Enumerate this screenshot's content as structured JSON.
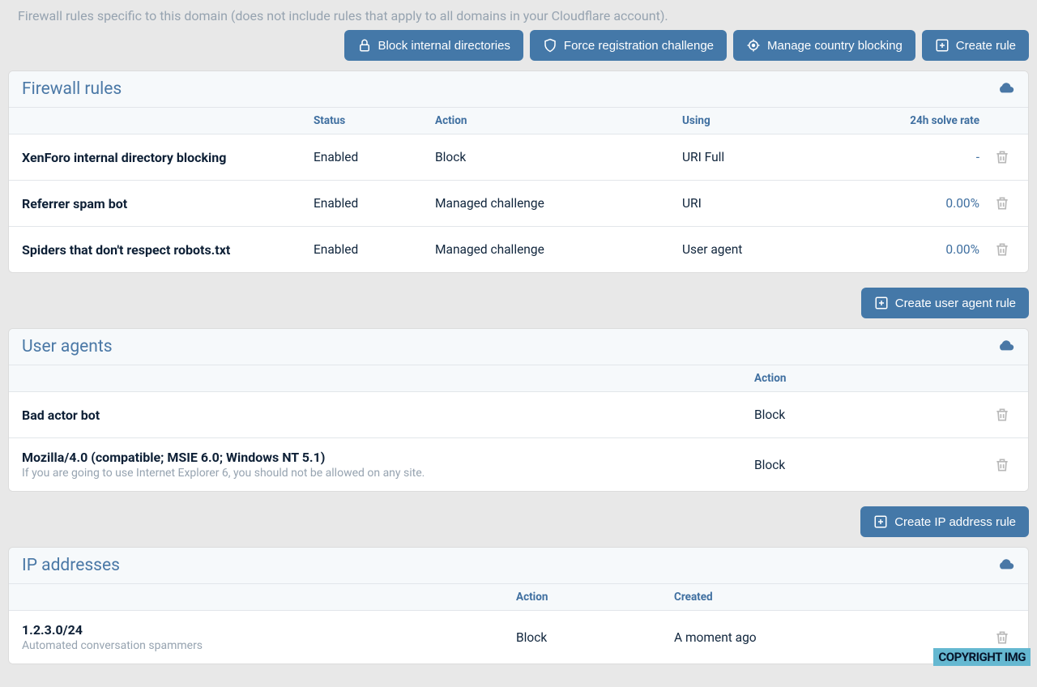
{
  "description": "Firewall rules specific to this domain (does not include rules that apply to all domains in your Cloudflare account).",
  "toolbar": {
    "block_dirs": "Block internal directories",
    "force_reg": "Force registration challenge",
    "manage_country": "Manage country blocking",
    "create_rule": "Create rule"
  },
  "firewall": {
    "title": "Firewall rules",
    "cols": {
      "status": "Status",
      "action": "Action",
      "using": "Using",
      "rate": "24h solve rate"
    },
    "rows": [
      {
        "name": "XenForo internal directory blocking",
        "status": "Enabled",
        "action": "Block",
        "using": "URI Full",
        "rate": "-"
      },
      {
        "name": "Referrer spam bot",
        "status": "Enabled",
        "action": "Managed challenge",
        "using": "URI",
        "rate": "0.00%"
      },
      {
        "name": "Spiders that don't respect robots.txt",
        "status": "Enabled",
        "action": "Managed challenge",
        "using": "User agent",
        "rate": "0.00%"
      }
    ]
  },
  "ua_toolbar": {
    "create": "Create user agent rule"
  },
  "user_agents": {
    "title": "User agents",
    "cols": {
      "action": "Action"
    },
    "rows": [
      {
        "name": "Bad actor bot",
        "subtext": "",
        "action": "Block"
      },
      {
        "name": "Mozilla/4.0 (compatible; MSIE 6.0; Windows NT 5.1)",
        "subtext": "If you are going to use Internet Explorer 6, you should not be allowed on any site.",
        "action": "Block"
      }
    ]
  },
  "ip_toolbar": {
    "create": "Create IP address rule"
  },
  "ip": {
    "title": "IP addresses",
    "cols": {
      "action": "Action",
      "created": "Created"
    },
    "rows": [
      {
        "name": "1.2.3.0/24",
        "subtext": "Automated conversation spammers",
        "action": "Block",
        "created": "A moment ago"
      }
    ]
  },
  "watermark": "COPYRIGHT IMG"
}
